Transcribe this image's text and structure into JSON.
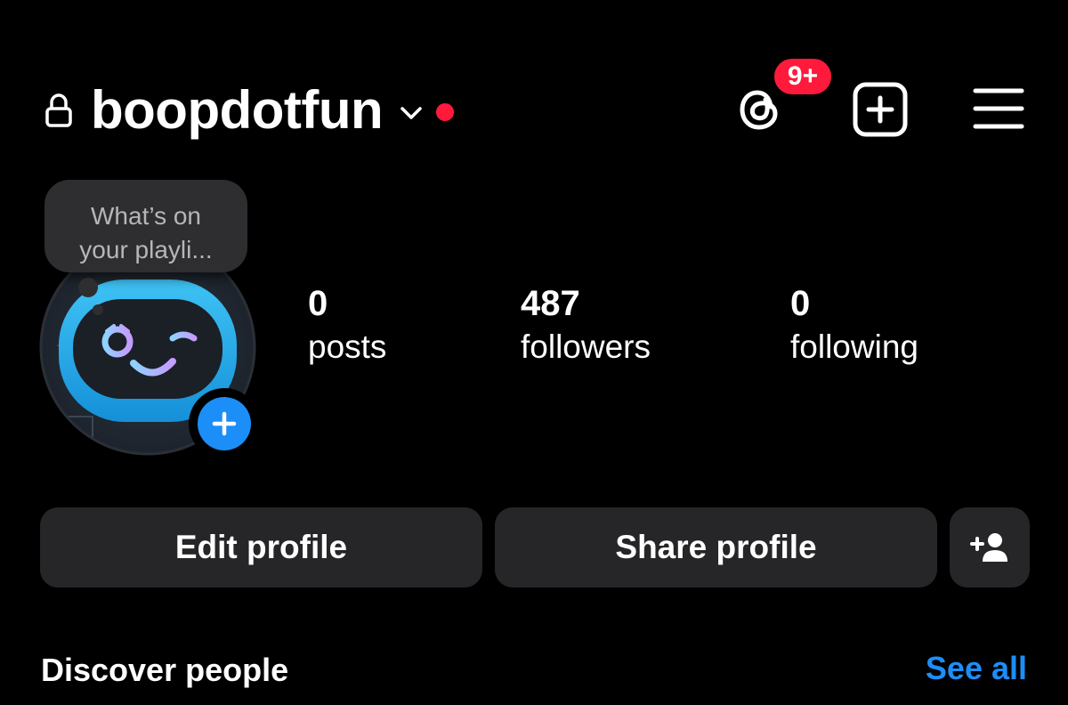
{
  "header": {
    "username": "boopdotfun",
    "lock_icon": "lock-icon",
    "chevron_icon": "chevron-down-icon",
    "status_dot_color": "#ff1a3c",
    "threads_icon": "threads-icon",
    "notification_badge": "9+",
    "create_icon": "plus-square-icon",
    "menu_icon": "hamburger-menu-icon"
  },
  "note": {
    "line1": "What’s on",
    "line2": "your playli..."
  },
  "avatar": {
    "icon": "robot-face-avatar",
    "add_story_icon": "plus-icon"
  },
  "stats": {
    "posts": {
      "count": "0",
      "label": "posts"
    },
    "followers": {
      "count": "487",
      "label": "followers"
    },
    "following": {
      "count": "0",
      "label": "following"
    }
  },
  "actions": {
    "edit_label": "Edit profile",
    "share_label": "Share profile",
    "add_person_icon": "add-person-icon"
  },
  "discover": {
    "title": "Discover people",
    "see_all": "See all"
  },
  "colors": {
    "background": "#000000",
    "button_bg": "#262628",
    "link_blue": "#1c8ef7",
    "badge_red": "#ff1a3c",
    "note_bg": "#2e2e30"
  }
}
